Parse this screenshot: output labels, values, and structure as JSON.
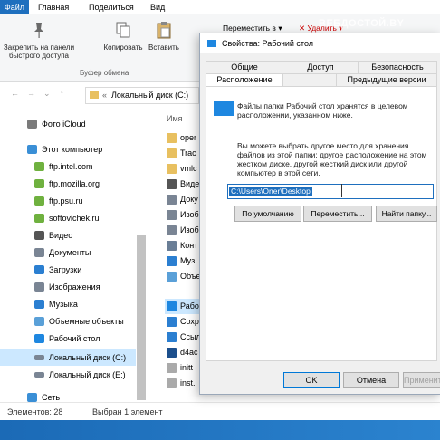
{
  "ribbon": {
    "tabs": [
      "Файл",
      "Главная",
      "Поделиться",
      "Вид"
    ],
    "buttons": [
      {
        "label": "Закрепить на панели быстрого доступа",
        "icon": "pin-icon"
      },
      {
        "label": "Копировать",
        "icon": "copy-icon"
      },
      {
        "label": "Вставить",
        "icon": "paste-icon"
      }
    ],
    "group_label": "Буфер обмена",
    "right_actions": [
      "Переместить в ▾",
      "✕ Удалить ▾"
    ]
  },
  "address": {
    "path": "Локальный диск (C:)"
  },
  "nav": {
    "items": [
      {
        "label": "Фото iCloud",
        "icon": "icloud-photos-icon",
        "color": "#7a7a7a"
      },
      {
        "label": "Этот компьютер",
        "icon": "computer-icon",
        "color": "#3a8fd6"
      },
      {
        "label": "ftp.intel.com",
        "icon": "network-folder-icon",
        "color": "#6fb13f"
      },
      {
        "label": "ftp.mozilla.org",
        "icon": "network-folder-icon",
        "color": "#6fb13f"
      },
      {
        "label": "ftp.psu.ru",
        "icon": "network-folder-icon",
        "color": "#6fb13f"
      },
      {
        "label": "softovichek.ru",
        "icon": "network-folder-icon",
        "color": "#6fb13f"
      },
      {
        "label": "Видео",
        "icon": "video-icon",
        "color": "#555"
      },
      {
        "label": "Документы",
        "icon": "documents-icon",
        "color": "#7a8594"
      },
      {
        "label": "Загрузки",
        "icon": "downloads-icon",
        "color": "#2b7fd1"
      },
      {
        "label": "Изображения",
        "icon": "pictures-icon",
        "color": "#7a8594"
      },
      {
        "label": "Музыка",
        "icon": "music-icon",
        "color": "#2b7fd1"
      },
      {
        "label": "Объемные объекты",
        "icon": "3d-objects-icon",
        "color": "#5aa0d8"
      },
      {
        "label": "Рабочий стол",
        "icon": "desktop-icon",
        "color": "#1e87e0"
      },
      {
        "label": "Локальный диск (C:)",
        "icon": "drive-icon",
        "color": "#7a8594"
      },
      {
        "label": "Локальный диск (E:)",
        "icon": "drive-icon",
        "color": "#7a8594"
      },
      {
        "label": "Сеть",
        "icon": "network-icon",
        "color": "#3a8fd6"
      }
    ]
  },
  "files": {
    "header": "Имя",
    "items": [
      {
        "label": "oper",
        "color": "#e8c060"
      },
      {
        "label": "Trac",
        "color": "#e8c060"
      },
      {
        "label": "vmlc",
        "color": "#e8c060"
      },
      {
        "label": "Виде",
        "color": "#555"
      },
      {
        "label": "Доку",
        "color": "#7a8594"
      },
      {
        "label": "Изоб",
        "color": "#7a8594"
      },
      {
        "label": "Изоб",
        "color": "#7a8594"
      },
      {
        "label": "Конт",
        "color": "#6a7e96"
      },
      {
        "label": "Муз",
        "color": "#2b7fd1"
      },
      {
        "label": "Объе",
        "color": "#5aa0d8"
      },
      {
        "label": "Рабо",
        "color": "#1e87e0"
      },
      {
        "label": "Сохр",
        "color": "#2b7fd1"
      },
      {
        "label": "Ссыл",
        "color": "#2b7fd1"
      },
      {
        "label": "d4ac",
        "color": "#1c4f8c"
      },
      {
        "label": "initt",
        "color": "#aaa"
      },
      {
        "label": "inst.",
        "color": "#aaa"
      }
    ]
  },
  "status": {
    "count": "Элементов: 28",
    "selected": "Выбран 1 элемент"
  },
  "dialog": {
    "title": "Свойства: Рабочий стол",
    "tabs_top": [
      "Общие",
      "Доступ",
      "Безопасность"
    ],
    "tabs_bottom": [
      "Расположение",
      "Предыдущие версии"
    ],
    "info": "Файлы папки Рабочий стол хранятся в целевом расположении, указанном ниже.",
    "desc": "Вы можете выбрать другое место для хранения файлов из этой папки: другое расположение на этом жестком диске, другой жесткий диск или другой компьютер в этой сети.",
    "path": "C:\\Users\\Oner\\Desktop",
    "btn_default": "По умолчанию",
    "btn_move": "Переместить...",
    "btn_find": "Найти папку...",
    "ok": "OK",
    "cancel": "Отмена",
    "apply": "Применить"
  },
  "watermark": "ВЕБДОСТОЙ.BY"
}
